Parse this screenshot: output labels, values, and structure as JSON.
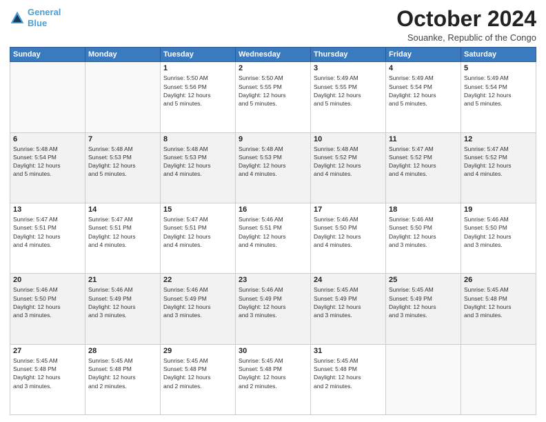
{
  "header": {
    "logo_line1": "General",
    "logo_line2": "Blue",
    "month": "October 2024",
    "location": "Souanke, Republic of the Congo"
  },
  "weekdays": [
    "Sunday",
    "Monday",
    "Tuesday",
    "Wednesday",
    "Thursday",
    "Friday",
    "Saturday"
  ],
  "weeks": [
    [
      {
        "day": "",
        "info": ""
      },
      {
        "day": "",
        "info": ""
      },
      {
        "day": "1",
        "info": "Sunrise: 5:50 AM\nSunset: 5:56 PM\nDaylight: 12 hours\nand 5 minutes."
      },
      {
        "day": "2",
        "info": "Sunrise: 5:50 AM\nSunset: 5:55 PM\nDaylight: 12 hours\nand 5 minutes."
      },
      {
        "day": "3",
        "info": "Sunrise: 5:49 AM\nSunset: 5:55 PM\nDaylight: 12 hours\nand 5 minutes."
      },
      {
        "day": "4",
        "info": "Sunrise: 5:49 AM\nSunset: 5:54 PM\nDaylight: 12 hours\nand 5 minutes."
      },
      {
        "day": "5",
        "info": "Sunrise: 5:49 AM\nSunset: 5:54 PM\nDaylight: 12 hours\nand 5 minutes."
      }
    ],
    [
      {
        "day": "6",
        "info": "Sunrise: 5:48 AM\nSunset: 5:54 PM\nDaylight: 12 hours\nand 5 minutes."
      },
      {
        "day": "7",
        "info": "Sunrise: 5:48 AM\nSunset: 5:53 PM\nDaylight: 12 hours\nand 5 minutes."
      },
      {
        "day": "8",
        "info": "Sunrise: 5:48 AM\nSunset: 5:53 PM\nDaylight: 12 hours\nand 4 minutes."
      },
      {
        "day": "9",
        "info": "Sunrise: 5:48 AM\nSunset: 5:53 PM\nDaylight: 12 hours\nand 4 minutes."
      },
      {
        "day": "10",
        "info": "Sunrise: 5:48 AM\nSunset: 5:52 PM\nDaylight: 12 hours\nand 4 minutes."
      },
      {
        "day": "11",
        "info": "Sunrise: 5:47 AM\nSunset: 5:52 PM\nDaylight: 12 hours\nand 4 minutes."
      },
      {
        "day": "12",
        "info": "Sunrise: 5:47 AM\nSunset: 5:52 PM\nDaylight: 12 hours\nand 4 minutes."
      }
    ],
    [
      {
        "day": "13",
        "info": "Sunrise: 5:47 AM\nSunset: 5:51 PM\nDaylight: 12 hours\nand 4 minutes."
      },
      {
        "day": "14",
        "info": "Sunrise: 5:47 AM\nSunset: 5:51 PM\nDaylight: 12 hours\nand 4 minutes."
      },
      {
        "day": "15",
        "info": "Sunrise: 5:47 AM\nSunset: 5:51 PM\nDaylight: 12 hours\nand 4 minutes."
      },
      {
        "day": "16",
        "info": "Sunrise: 5:46 AM\nSunset: 5:51 PM\nDaylight: 12 hours\nand 4 minutes."
      },
      {
        "day": "17",
        "info": "Sunrise: 5:46 AM\nSunset: 5:50 PM\nDaylight: 12 hours\nand 4 minutes."
      },
      {
        "day": "18",
        "info": "Sunrise: 5:46 AM\nSunset: 5:50 PM\nDaylight: 12 hours\nand 3 minutes."
      },
      {
        "day": "19",
        "info": "Sunrise: 5:46 AM\nSunset: 5:50 PM\nDaylight: 12 hours\nand 3 minutes."
      }
    ],
    [
      {
        "day": "20",
        "info": "Sunrise: 5:46 AM\nSunset: 5:50 PM\nDaylight: 12 hours\nand 3 minutes."
      },
      {
        "day": "21",
        "info": "Sunrise: 5:46 AM\nSunset: 5:49 PM\nDaylight: 12 hours\nand 3 minutes."
      },
      {
        "day": "22",
        "info": "Sunrise: 5:46 AM\nSunset: 5:49 PM\nDaylight: 12 hours\nand 3 minutes."
      },
      {
        "day": "23",
        "info": "Sunrise: 5:46 AM\nSunset: 5:49 PM\nDaylight: 12 hours\nand 3 minutes."
      },
      {
        "day": "24",
        "info": "Sunrise: 5:45 AM\nSunset: 5:49 PM\nDaylight: 12 hours\nand 3 minutes."
      },
      {
        "day": "25",
        "info": "Sunrise: 5:45 AM\nSunset: 5:49 PM\nDaylight: 12 hours\nand 3 minutes."
      },
      {
        "day": "26",
        "info": "Sunrise: 5:45 AM\nSunset: 5:48 PM\nDaylight: 12 hours\nand 3 minutes."
      }
    ],
    [
      {
        "day": "27",
        "info": "Sunrise: 5:45 AM\nSunset: 5:48 PM\nDaylight: 12 hours\nand 3 minutes."
      },
      {
        "day": "28",
        "info": "Sunrise: 5:45 AM\nSunset: 5:48 PM\nDaylight: 12 hours\nand 2 minutes."
      },
      {
        "day": "29",
        "info": "Sunrise: 5:45 AM\nSunset: 5:48 PM\nDaylight: 12 hours\nand 2 minutes."
      },
      {
        "day": "30",
        "info": "Sunrise: 5:45 AM\nSunset: 5:48 PM\nDaylight: 12 hours\nand 2 minutes."
      },
      {
        "day": "31",
        "info": "Sunrise: 5:45 AM\nSunset: 5:48 PM\nDaylight: 12 hours\nand 2 minutes."
      },
      {
        "day": "",
        "info": ""
      },
      {
        "day": "",
        "info": ""
      }
    ]
  ]
}
